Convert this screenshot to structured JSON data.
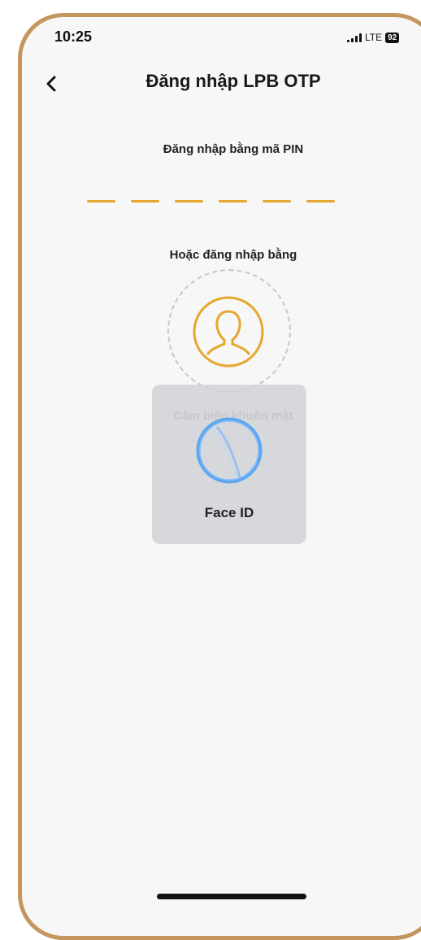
{
  "status_bar": {
    "time": "10:25",
    "network": "LTE",
    "battery": "92"
  },
  "header": {
    "title": "Đăng nhập LPB OTP"
  },
  "pin_section": {
    "label": "Đăng nhập bằng mã PIN",
    "digit_count": 6,
    "accent_color": "#e5a72e"
  },
  "alt_login": {
    "label": "Hoặc đăng nhập bằng",
    "face_label": "Cảm biến khuôn mặt"
  },
  "face_id_prompt": {
    "label": "Face ID"
  },
  "colors": {
    "frame": "#c4965e",
    "background": "#f7f7f8",
    "face_icon": "#e5a72e",
    "face_id_blue": "#4a9df5"
  }
}
